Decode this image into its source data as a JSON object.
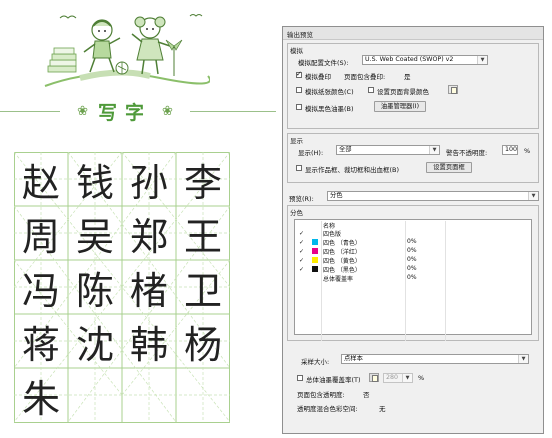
{
  "practice": {
    "banner_text": "写字",
    "characters": [
      "赵",
      "钱",
      "孙",
      "李",
      "周",
      "吴",
      "郑",
      "王",
      "冯",
      "陈",
      "楮",
      "卫",
      "蒋",
      "沈",
      "韩",
      "杨",
      "朱"
    ]
  },
  "dialog": {
    "title": "输出预览",
    "simulation": {
      "title": "模拟",
      "profile_label": "模拟配置文件(S):",
      "profile_value": "U.S. Web Coated (SWOP) v2",
      "overprint_label": "模拟叠印",
      "page_overprint_label": "页面包含叠印:",
      "page_overprint_value": "是",
      "paper_color_label": "模拟纸张颜色(C)",
      "page_bg_label": "设置页面背景颜色",
      "black_ink_label": "模拟黑色油墨(B)",
      "ink_manager_button": "油墨管理器(I)"
    },
    "display": {
      "title": "显示",
      "show_label": "显示(H):",
      "show_value": "全部",
      "warn_opacity_label": "警告不透明度:",
      "warn_opacity_value": "100",
      "percent": "%",
      "artbox_label": "显示作品框、裁切框和出血框(B)",
      "page_box_button": "设置页面框"
    },
    "preview": {
      "label": "预览(R):",
      "value": "分色"
    },
    "separations": {
      "title": "分色",
      "column_name": "名称",
      "rows": [
        {
          "name": "四色版",
          "value": "",
          "checked": true,
          "color": ""
        },
        {
          "name": "四色 （青色）",
          "value": "0%",
          "checked": true,
          "color": "#00b7eb"
        },
        {
          "name": "四色 （洋红）",
          "value": "0%",
          "checked": true,
          "color": "#e8008a"
        },
        {
          "name": "四色 （黄色）",
          "value": "0%",
          "checked": true,
          "color": "#ffec00"
        },
        {
          "name": "四色 （黑色）",
          "value": "0%",
          "checked": true,
          "color": "#111111"
        },
        {
          "name": "总体覆盖率",
          "value": "0%",
          "checked": false,
          "color": ""
        }
      ]
    },
    "sample": {
      "sample_size_label": "采样大小:",
      "sample_size_value": "点样本",
      "total_coverage_label": "总体油墨覆盖率(T)",
      "total_coverage_value": "280",
      "percent": "%",
      "page_transparency_label": "页面包含透明度:",
      "page_transparency_value": "否",
      "blend_space_label": "透明度混合色彩空间:",
      "blend_space_value": "无"
    }
  }
}
